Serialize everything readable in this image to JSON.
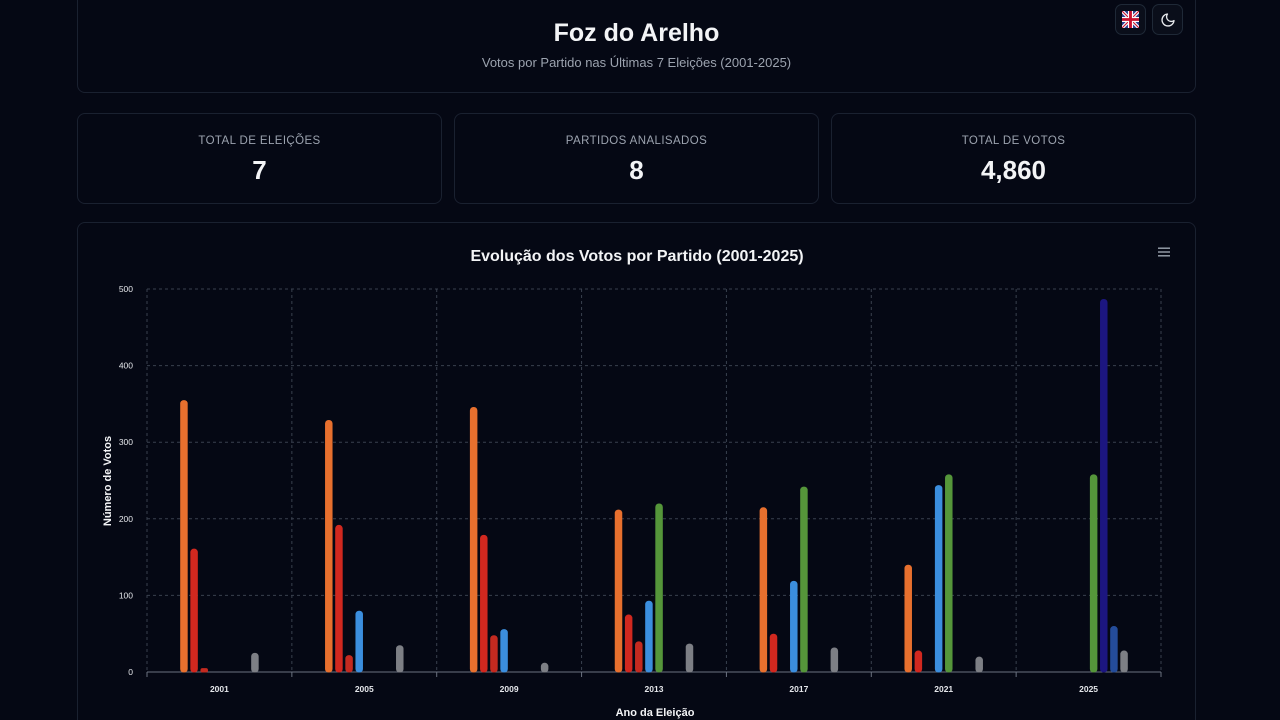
{
  "header": {
    "title": "Foz do Arelho",
    "subtitle": "Votos por Partido nas Últimas 7 Eleições (2001-2025)",
    "language_button_icon": "uk-flag-icon",
    "theme_button_icon": "moon-icon"
  },
  "stats": [
    {
      "label": "TOTAL DE ELEIÇÕES",
      "value": "7"
    },
    {
      "label": "PARTIDOS ANALISADOS",
      "value": "8"
    },
    {
      "label": "TOTAL DE VOTOS",
      "value": "4,860"
    }
  ],
  "chart_menu_icon": "hamburger-menu-icon",
  "chart_data": {
    "type": "bar",
    "title": "Evolução dos Votos por Partido (2001-2025)",
    "xlabel": "Ano da Eleição",
    "ylabel": "Número de Votos",
    "categories": [
      "2001",
      "2005",
      "2009",
      "2013",
      "2017",
      "2021",
      "2025"
    ],
    "ylim": [
      0,
      500
    ],
    "yticks": [
      0,
      100,
      200,
      300,
      400,
      500
    ],
    "grid": true,
    "series": [
      {
        "color": "#e8702e",
        "values": [
          355,
          329,
          346,
          212,
          215,
          140,
          0
        ]
      },
      {
        "color": "#d1281f",
        "values": [
          161,
          192,
          179,
          75,
          50,
          28,
          0
        ]
      },
      {
        "color": "#c42a20",
        "values": [
          5,
          22,
          48,
          40,
          0,
          0,
          0
        ]
      },
      {
        "color": "#3b8ede",
        "values": [
          0,
          80,
          56,
          93,
          119,
          244,
          0
        ]
      },
      {
        "color": "#55963a",
        "values": [
          0,
          0,
          0,
          220,
          242,
          258,
          258
        ]
      },
      {
        "color": "#1c1680",
        "values": [
          0,
          0,
          0,
          0,
          0,
          0,
          487
        ]
      },
      {
        "color": "#244c9a",
        "values": [
          0,
          0,
          0,
          0,
          0,
          0,
          60
        ]
      },
      {
        "color": "#7d7f85",
        "values": [
          25,
          35,
          12,
          37,
          32,
          20,
          28
        ]
      }
    ]
  }
}
